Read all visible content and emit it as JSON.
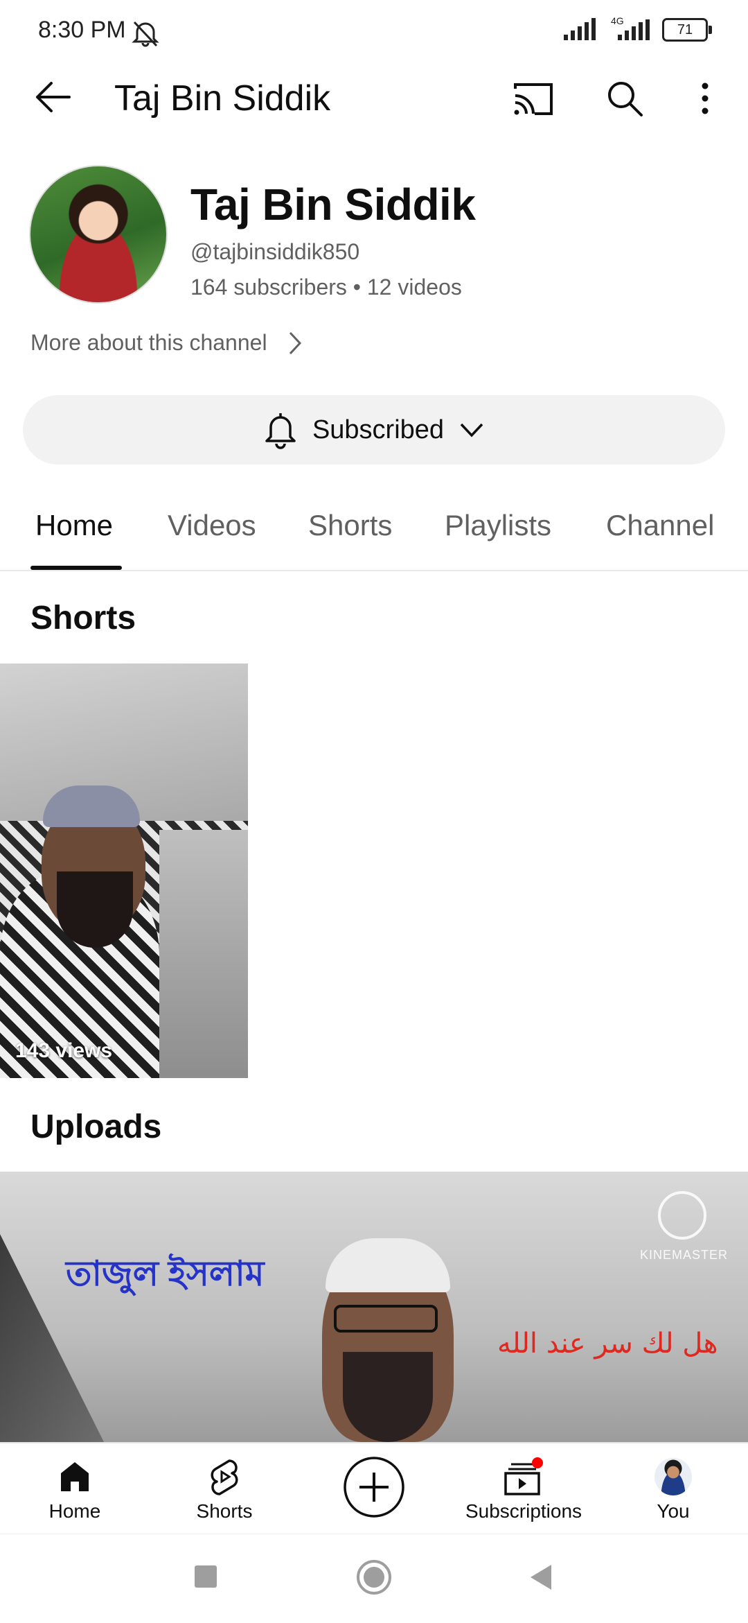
{
  "status_bar": {
    "time": "8:30 PM",
    "network": "4G",
    "battery": "71"
  },
  "app_bar": {
    "title": "Taj Bin Siddik"
  },
  "channel": {
    "name": "Taj Bin Siddik",
    "handle": "@tajbinsiddik850",
    "meta": "164 subscribers • 12 videos",
    "more_about": "More about this channel",
    "subscribe_label": "Subscribed"
  },
  "tabs": [
    {
      "label": "Home",
      "active": true
    },
    {
      "label": "Videos",
      "active": false
    },
    {
      "label": "Shorts",
      "active": false
    },
    {
      "label": "Playlists",
      "active": false
    },
    {
      "label": "Channel",
      "active": false
    }
  ],
  "sections": {
    "shorts_title": "Shorts",
    "uploads_title": "Uploads"
  },
  "shorts": [
    {
      "views": "143 views"
    }
  ],
  "uploads": [
    {
      "overlay_bengali": "তাজুল ইসলাম",
      "overlay_arabic": "هل لك سر عند الله",
      "watermark": "KINEMASTER"
    }
  ],
  "bottom_nav": [
    {
      "label": "Home",
      "icon": "home-icon"
    },
    {
      "label": "Shorts",
      "icon": "shorts-icon"
    },
    {
      "label": "",
      "icon": "create-icon"
    },
    {
      "label": "Subscriptions",
      "icon": "subscriptions-icon"
    },
    {
      "label": "You",
      "icon": "avatar-icon"
    }
  ],
  "colors": {
    "text_primary": "#0f0f0f",
    "text_secondary": "#606060",
    "pill_bg": "#f2f2f2",
    "notification_dot": "#ff0000"
  }
}
